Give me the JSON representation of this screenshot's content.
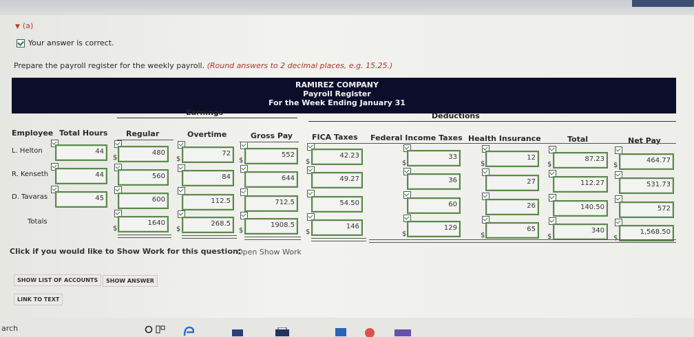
{
  "section": {
    "label": "(a)"
  },
  "feedback": {
    "text": "Your answer is correct."
  },
  "instructions": {
    "text": "Prepare the payroll register for the weekly payroll.",
    "note": "(Round answers to 2 decimal places, e.g. 15.25.)"
  },
  "register": {
    "company": "RAMIREZ COMPANY",
    "title": "Payroll Register",
    "period": "For the Week Ending January 31",
    "group_earnings": "Earnings",
    "group_deductions": "Deductions",
    "columns": {
      "employee": "Employee",
      "hours": "Total Hours",
      "regular": "Regular",
      "overtime": "Overtime",
      "gross": "Gross Pay",
      "fica": "FICA Taxes",
      "federal": "Federal Income Taxes",
      "health": "Health Insurance",
      "total": "Total",
      "net": "Net Pay"
    },
    "currency_symbol": "$",
    "rows": [
      {
        "employee": "L. Helton",
        "hours": "44",
        "regular": "480",
        "overtime": "72",
        "gross": "552",
        "fica": "42.23",
        "federal": "33",
        "health": "12",
        "total": "87.23",
        "net": "464.77"
      },
      {
        "employee": "R. Kenseth",
        "hours": "44",
        "regular": "560",
        "overtime": "84",
        "gross": "644",
        "fica": "49.27",
        "federal": "36",
        "health": "27",
        "total": "112.27",
        "net": "531.73"
      },
      {
        "employee": "D. Tavaras",
        "hours": "45",
        "regular": "600",
        "overtime": "112.5",
        "gross": "712.5",
        "fica": "54.50",
        "federal": "60",
        "health": "26",
        "total": "140.50",
        "net": "572"
      }
    ],
    "totals": {
      "label": "Totals",
      "regular": "1640",
      "overtime": "268.5",
      "gross": "1908.5",
      "fica": "146",
      "federal": "129",
      "health": "65",
      "total": "340",
      "net": "1,568.50"
    }
  },
  "show_work": {
    "prompt": "Click if you would like to Show Work for this question:",
    "link": "Open Show Work"
  },
  "buttons": {
    "show_accounts": "SHOW LIST OF ACCOUNTS",
    "show_answer": "SHOW ANSWER",
    "link_to_text": "LINK TO TEXT"
  },
  "taskbar": {
    "search_fragment": "arch"
  }
}
